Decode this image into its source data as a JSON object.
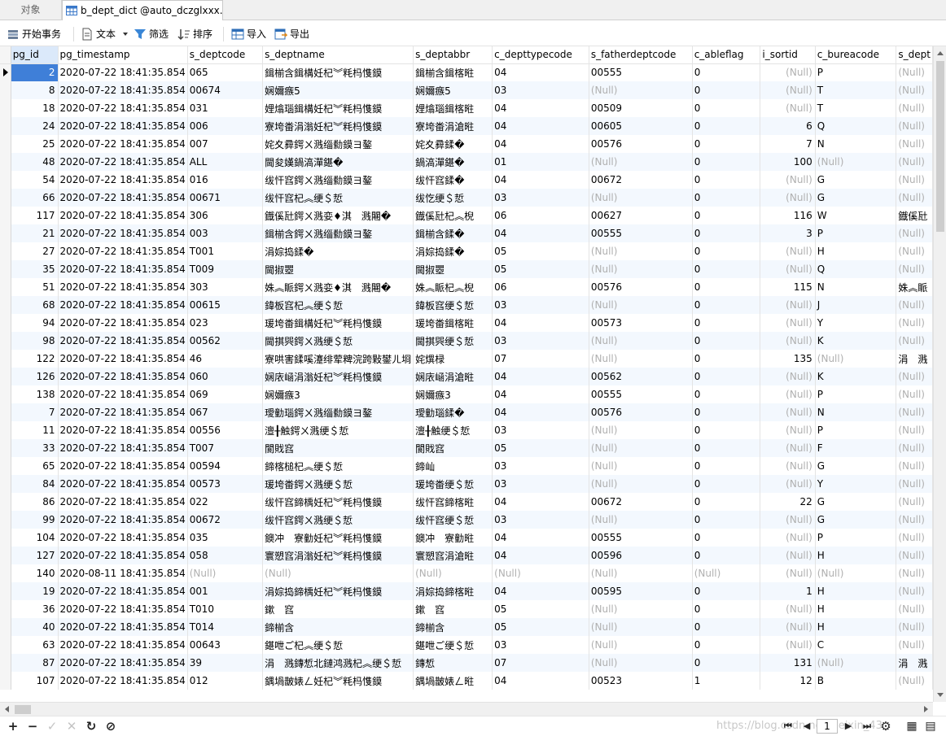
{
  "tabs": {
    "objects_label": "对象",
    "active_label": "b_dept_dict @auto_dczglxxx..."
  },
  "toolbar": {
    "begin_transaction": "开始事务",
    "text": "文本",
    "filter": "筛选",
    "sort": "排序",
    "import": "导入",
    "export": "导出"
  },
  "columns": [
    "pg_id",
    "pg_timestamp",
    "s_deptcode",
    "s_deptname",
    "s_deptabbr",
    "c_depttypecode",
    "s_fatherdeptcode",
    "c_ableflag",
    "i_sortid",
    "c_bureacode",
    "s_dept"
  ],
  "rows": [
    [
      "2",
      "2020-07-22 18:41:35.854",
      "065",
      "鍓椾含鍓構妊杞︾粍杩愯鏌",
      "鍓椾含鍓楁暀",
      "04",
      "00555",
      "0",
      "(Null)",
      "P",
      "(Null)"
    ],
    [
      "8",
      "2020-07-22 18:41:35.854",
      "00674",
      "娴嬭瘯5",
      "娴嬭瘯5",
      "03",
      "(Null)",
      "0",
      "(Null)",
      "T",
      "(Null)"
    ],
    [
      "18",
      "2020-07-22 18:41:35.854",
      "031",
      "娌熻瑙鍓構妊杞︾粍杩愯鏌",
      "娌熻瑙鍓楁暀",
      "04",
      "00509",
      "0",
      "(Null)",
      "T",
      "(Null)"
    ],
    [
      "24",
      "2020-07-22 18:41:35.854",
      "006",
      "寮垮畨涓滃妊杞︾粍杩愯鏌",
      "寮垮畨涓滄暀",
      "04",
      "00605",
      "0",
      "6",
      "Q",
      "(Null)"
    ],
    [
      "25",
      "2020-07-22 18:41:35.854",
      "007",
      "姹夊彛鍔ㄨ溅缁勬鏌ヨ鏊",
      "姹夊彛鍒�",
      "04",
      "00576",
      "0",
      "7",
      "N",
      "(Null)"
    ],
    [
      "48",
      "2020-07-22 18:41:35.854",
      "ALL",
      "閫夋嫨鍋滈潬鍖�",
      "鍋滈潬鍖�",
      "01",
      "(Null)",
      "0",
      "100",
      "(Null)",
      "(Null)"
    ],
    [
      "54",
      "2020-07-22 18:41:35.854",
      "016",
      "绂忓窞鍔ㄨ溅缁勬鏌ヨ鏊",
      "绂忓窞鍒�",
      "04",
      "00672",
      "0",
      "(Null)",
      "G",
      "(Null)"
    ],
    [
      "66",
      "2020-07-22 18:41:35.854",
      "00671",
      "绂忓窞杞︽绠＄悊",
      "绂忔绠＄悊",
      "03",
      "(Null)",
      "0",
      "(Null)",
      "G",
      "(Null)"
    ],
    [
      "117",
      "2020-07-22 18:41:35.854",
      "306",
      "鐡傒瓧鍔ㄨ溅娈♦淇　溅闀�",
      "鐡傒瓧杞︽棿",
      "06",
      "00627",
      "0",
      "116",
      "W",
      "鐡傒瓧"
    ],
    [
      "21",
      "2020-07-22 18:41:35.854",
      "003",
      "鍓椾含鍔ㄨ溅缁勬鏌ヨ鏊",
      "鍓椾含鍒�",
      "04",
      "00555",
      "0",
      "3",
      "P",
      "(Null)"
    ],
    [
      "27",
      "2020-07-22 18:41:35.854",
      "T001",
      "涓婃捣鍒�",
      "涓婃捣鍒�",
      "05",
      "(Null)",
      "0",
      "(Null)",
      "H",
      "(Null)"
    ],
    [
      "35",
      "2020-07-22 18:41:35.854",
      "T009",
      "閫掓瞾",
      "閫掓瞾",
      "05",
      "(Null)",
      "0",
      "(Null)",
      "Q",
      "(Null)"
    ],
    [
      "51",
      "2020-07-22 18:41:35.854",
      "303",
      "姝︽眽鍔ㄨ溅娈♦淇　溅闀�",
      "姝︽眽杞︽棿",
      "06",
      "00576",
      "0",
      "115",
      "N",
      "姝︽眽"
    ],
    [
      "68",
      "2020-07-22 18:41:35.854",
      "00615",
      "鍏板窞杞︽绠＄悊",
      "鍏板窞绠＄悊",
      "03",
      "(Null)",
      "0",
      "(Null)",
      "J",
      "(Null)"
    ],
    [
      "94",
      "2020-07-22 18:41:35.854",
      "023",
      "瑗垮畨鍓構妊杞︾粍杩愯鏌",
      "瑗垮畨鍓楁暀",
      "04",
      "00573",
      "0",
      "(Null)",
      "Y",
      "(Null)"
    ],
    [
      "98",
      "2020-07-22 18:41:35.854",
      "00562",
      "閫掑巺鍔ㄨ溅绠＄悊",
      "閫掑巺绠＄悊",
      "03",
      "(Null)",
      "0",
      "(Null)",
      "K",
      "(Null)"
    ],
    [
      "122",
      "2020-07-22 18:41:35.854",
      "46",
      "寮哄害鍒嗘瀽绯荤粺浣跨敤鐢ㄦ埛",
      "姹熼椂",
      "07",
      "(Null)",
      "0",
      "135",
      "(Null)",
      "涓　溅"
    ],
    [
      "126",
      "2020-07-22 18:41:35.854",
      "060",
      "娴庡崡涓滃妊杞︾粍杩愯鏌",
      "娴庡崡涓滄暀",
      "04",
      "00562",
      "0",
      "(Null)",
      "K",
      "(Null)"
    ],
    [
      "138",
      "2020-07-22 18:41:35.854",
      "069",
      "娴嬭瘯3",
      "娴嬭瘯3",
      "04",
      "00555",
      "0",
      "(Null)",
      "P",
      "(Null)"
    ],
    [
      "7",
      "2020-07-22 18:41:35.854",
      "067",
      "璦勭瑙鍔ㄨ溅缁勬鏌ヨ鏊",
      "璦勭瑙鍒�",
      "04",
      "00576",
      "0",
      "(Null)",
      "N",
      "(Null)"
    ],
    [
      "11",
      "2020-07-22 18:41:35.854",
      "00556",
      "澶╂触鍔ㄨ溅绠＄悊",
      "澶╂触绠＄悊",
      "03",
      "(Null)",
      "0",
      "(Null)",
      "P",
      "(Null)"
    ],
    [
      "33",
      "2020-07-22 18:41:35.854",
      "T007",
      "閬戝窞",
      "閬戝窞",
      "05",
      "(Null)",
      "0",
      "(Null)",
      "F",
      "(Null)"
    ],
    [
      "65",
      "2020-07-22 18:41:35.854",
      "00594",
      "鍗楁槌杞︽绠＄悊",
      "鍗屾",
      "03",
      "(Null)",
      "0",
      "(Null)",
      "G",
      "(Null)"
    ],
    [
      "84",
      "2020-07-22 18:41:35.854",
      "00573",
      "瑗垮畨鍔ㄨ溅绠＄悊",
      "瑗垮畨绠＄悊",
      "03",
      "(Null)",
      "0",
      "(Null)",
      "Y",
      "(Null)"
    ],
    [
      "86",
      "2020-07-22 18:41:35.854",
      "022",
      "绂忓窞鍗楀妊杞︾粍杩愯鏌",
      "绂忓窞鍗楁暀",
      "04",
      "00672",
      "0",
      "22",
      "G",
      "(Null)"
    ],
    [
      "99",
      "2020-07-22 18:41:35.854",
      "00672",
      "绂忓窞鍔ㄨ溅绠＄悊",
      "绂忓窞绠＄悊",
      "03",
      "(Null)",
      "0",
      "(Null)",
      "G",
      "(Null)"
    ],
    [
      "104",
      "2020-07-22 18:41:35.854",
      "035",
      "鐭冲　寮勭妊杞︾粍杩愯鏌",
      "鐭冲　寮勭暀",
      "04",
      "00555",
      "0",
      "(Null)",
      "P",
      "(Null)"
    ],
    [
      "127",
      "2020-07-22 18:41:35.854",
      "058",
      "寰愬窞涓滃妊杞︾粍杩愯鏌",
      "寰愬窞涓滄暀",
      "04",
      "00596",
      "0",
      "(Null)",
      "H",
      "(Null)"
    ],
    [
      "140",
      "2020-08-11 18:41:35.854",
      "(Null)",
      "(Null)",
      "(Null)",
      "(Null)",
      "(Null)",
      "(Null)",
      "(Null)",
      "(Null)",
      "(Null)"
    ],
    [
      "19",
      "2020-07-22 18:41:35.854",
      "001",
      "涓婃捣鍗楀妊杞︾粍杩愯鏌",
      "涓婃捣鍗楁暀",
      "04",
      "00595",
      "0",
      "1",
      "H",
      "(Null)"
    ],
    [
      "36",
      "2020-07-22 18:41:35.854",
      "T010",
      "鏉　窞",
      "鏉　窞",
      "05",
      "(Null)",
      "0",
      "(Null)",
      "H",
      "(Null)"
    ],
    [
      "40",
      "2020-07-22 18:41:35.854",
      "T014",
      "鍗椾含",
      "鍗椾含",
      "05",
      "(Null)",
      "0",
      "(Null)",
      "H",
      "(Null)"
    ],
    [
      "63",
      "2020-07-22 18:41:35.854",
      "00643",
      "鍖呭ご杞︽绠＄悊",
      "鍖呭ご绠＄悊",
      "03",
      "(Null)",
      "0",
      "(Null)",
      "C",
      "(Null)"
    ],
    [
      "87",
      "2020-07-22 18:41:35.854",
      "39",
      "涓　溅鏄惁北鏈鸿溅杞︽绠＄悊",
      "鏄惁",
      "07",
      "(Null)",
      "0",
      "131",
      "(Null)",
      "涓　溅"
    ],
    [
      "107",
      "2020-07-22 18:41:35.854",
      "012",
      "鍝堝皵婊ㄥ妊杞︾粍杩愯鏌",
      "鍝堝皵婊ㄥ暀",
      "04",
      "00523",
      "1",
      "12",
      "B",
      "(Null)"
    ]
  ],
  "bottom": {
    "watermark": "https://blog.csdn.net/weixin_43",
    "page": "1"
  }
}
